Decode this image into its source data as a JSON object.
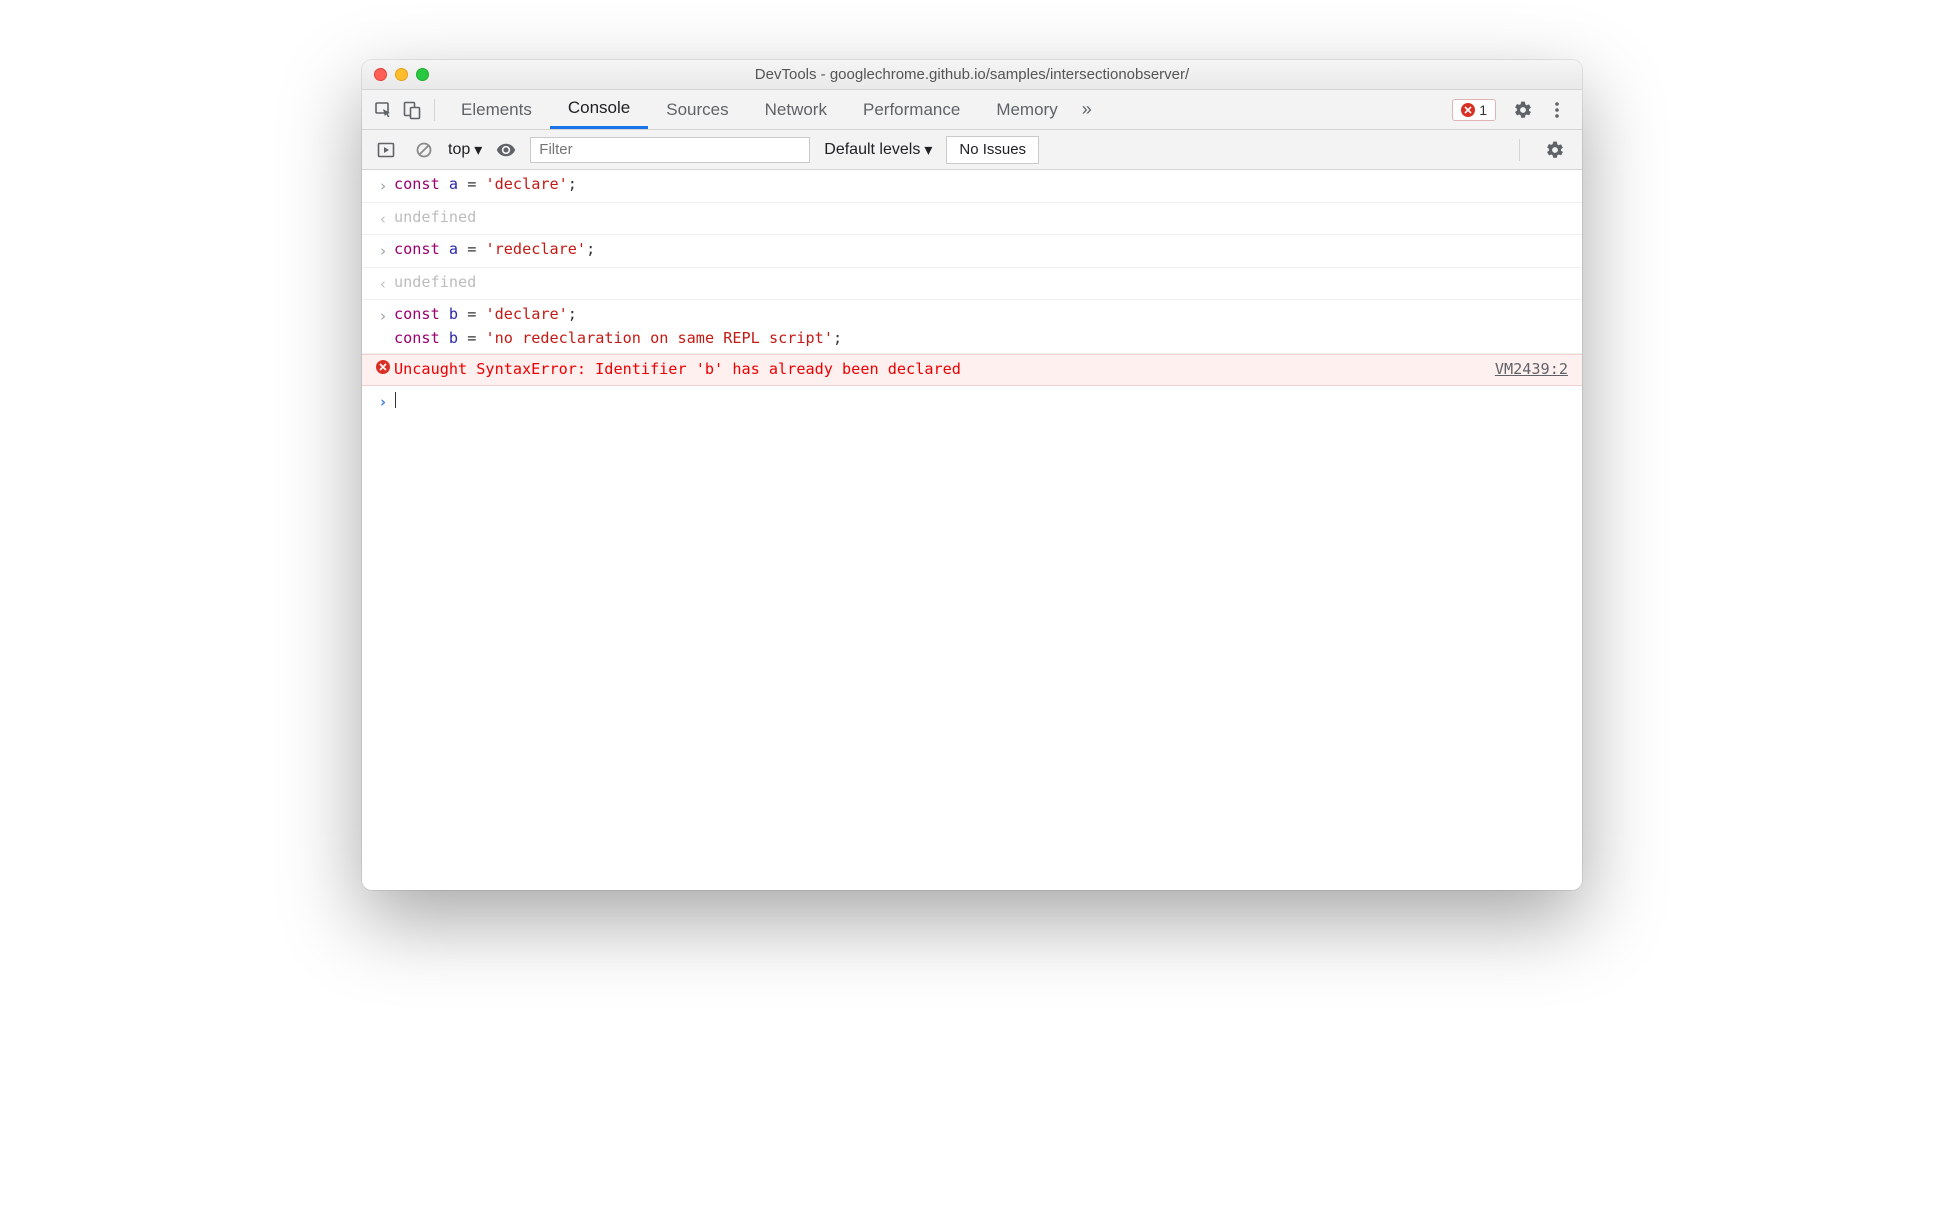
{
  "window": {
    "title": "DevTools - googlechrome.github.io/samples/intersectionobserver/"
  },
  "tabs": {
    "items": [
      {
        "label": "Elements"
      },
      {
        "label": "Console",
        "active": true
      },
      {
        "label": "Sources"
      },
      {
        "label": "Network"
      },
      {
        "label": "Performance"
      },
      {
        "label": "Memory"
      }
    ]
  },
  "toolbar": {
    "error_count": "1"
  },
  "filter": {
    "context": "top",
    "placeholder": "Filter",
    "levels_label": "Default levels",
    "issues_label": "No Issues"
  },
  "console": {
    "rows": [
      {
        "type": "input",
        "tokens": [
          {
            "t": "kw",
            "v": "const"
          },
          {
            "t": "sp",
            "v": " "
          },
          {
            "t": "ident",
            "v": "a"
          },
          {
            "t": "sp",
            "v": " "
          },
          {
            "t": "op",
            "v": "="
          },
          {
            "t": "sp",
            "v": " "
          },
          {
            "t": "str",
            "v": "'declare'"
          },
          {
            "t": "op",
            "v": ";"
          }
        ]
      },
      {
        "type": "output",
        "tokens": [
          {
            "t": "muted",
            "v": "undefined"
          }
        ]
      },
      {
        "type": "input",
        "tokens": [
          {
            "t": "kw",
            "v": "const"
          },
          {
            "t": "sp",
            "v": " "
          },
          {
            "t": "ident",
            "v": "a"
          },
          {
            "t": "sp",
            "v": " "
          },
          {
            "t": "op",
            "v": "="
          },
          {
            "t": "sp",
            "v": " "
          },
          {
            "t": "str",
            "v": "'redeclare'"
          },
          {
            "t": "op",
            "v": ";"
          }
        ]
      },
      {
        "type": "output",
        "tokens": [
          {
            "t": "muted",
            "v": "undefined"
          }
        ]
      },
      {
        "type": "input",
        "multiline": true,
        "lines": [
          [
            {
              "t": "kw",
              "v": "const"
            },
            {
              "t": "sp",
              "v": " "
            },
            {
              "t": "ident",
              "v": "b"
            },
            {
              "t": "sp",
              "v": " "
            },
            {
              "t": "op",
              "v": "="
            },
            {
              "t": "sp",
              "v": " "
            },
            {
              "t": "str",
              "v": "'declare'"
            },
            {
              "t": "op",
              "v": ";"
            }
          ],
          [
            {
              "t": "kw",
              "v": "const"
            },
            {
              "t": "sp",
              "v": " "
            },
            {
              "t": "ident",
              "v": "b"
            },
            {
              "t": "sp",
              "v": " "
            },
            {
              "t": "op",
              "v": "="
            },
            {
              "t": "sp",
              "v": " "
            },
            {
              "t": "str",
              "v": "'no redeclaration on same REPL script'"
            },
            {
              "t": "op",
              "v": ";"
            }
          ]
        ]
      },
      {
        "type": "error",
        "text": "Uncaught SyntaxError: Identifier 'b' has already been declared",
        "link": "VM2439:2"
      },
      {
        "type": "prompt"
      }
    ]
  }
}
